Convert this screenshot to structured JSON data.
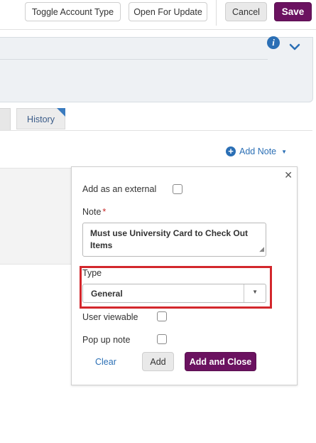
{
  "toolbar": {
    "toggle_label": "Toggle Account Type",
    "open_update_label": "Open For Update",
    "cancel_label": "Cancel",
    "save_label": "Save"
  },
  "tabs": {
    "history_label": "History"
  },
  "notes": {
    "add_note_label": "Add Note"
  },
  "popover": {
    "external_label": "Add as an external",
    "note_label": "Note",
    "required_mark": "*",
    "note_value_line1": "Must use University Card to Check Out",
    "note_value_line2": "Items",
    "type_label": "Type",
    "type_value": "General",
    "user_viewable_label": "User viewable",
    "popup_note_label": "Pop up note",
    "clear_label": "Clear",
    "add_label": "Add",
    "add_close_label": "Add and Close"
  },
  "colors": {
    "brand_purple": "#6b1260",
    "link_blue": "#2b6fb5",
    "highlight_red": "#d3272c"
  }
}
